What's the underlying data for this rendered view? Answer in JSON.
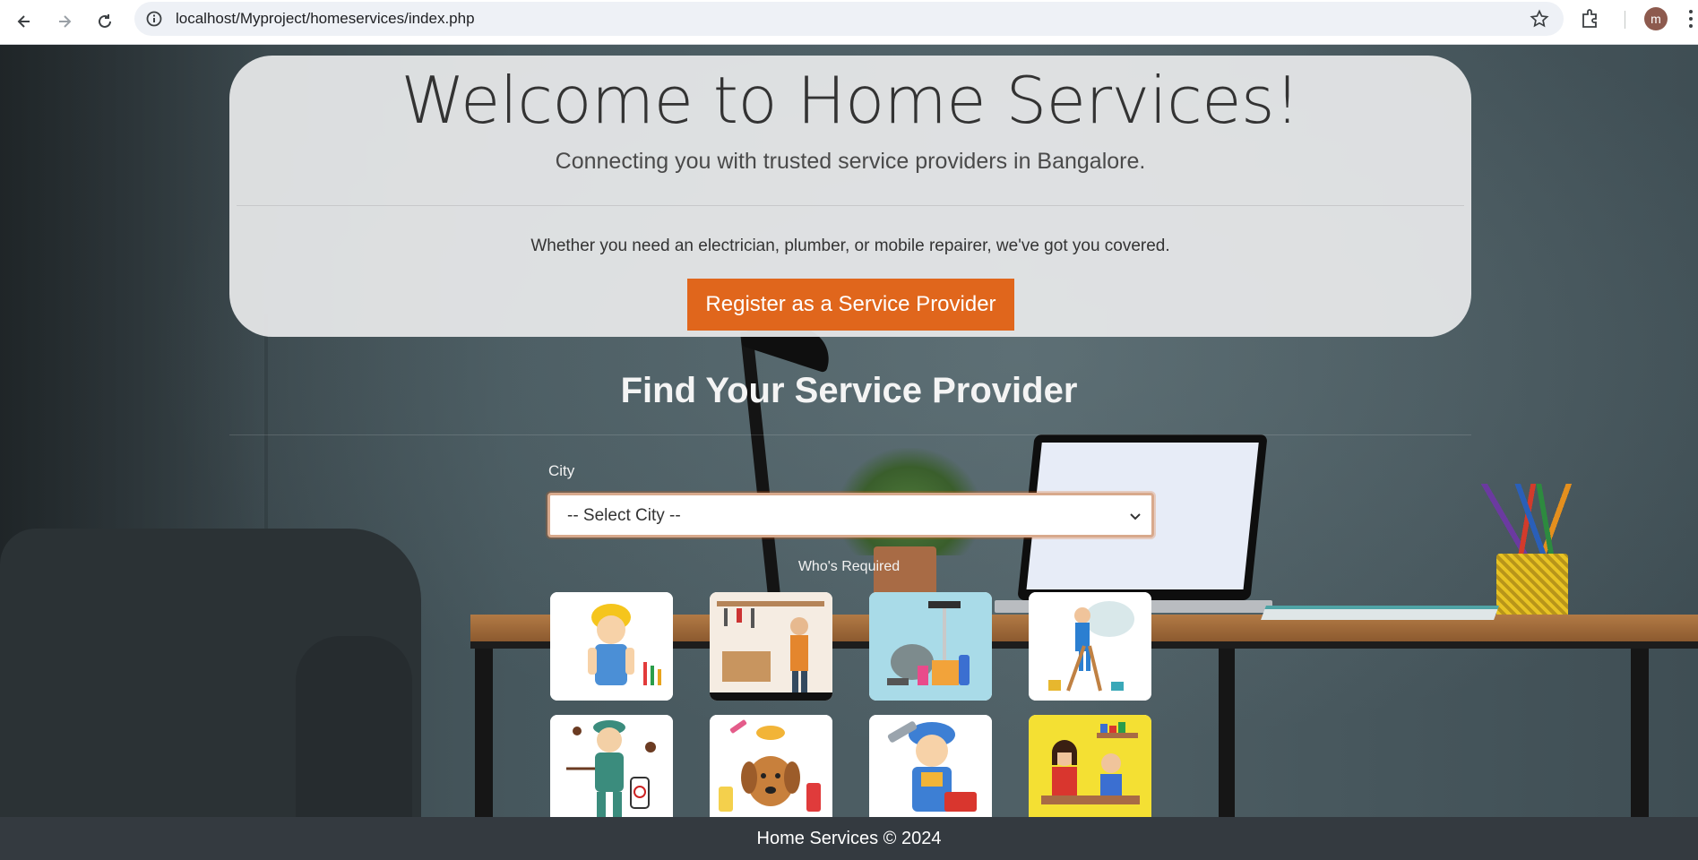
{
  "browser": {
    "url": "localhost/Myproject/homeservices/index.php",
    "profile_initial": "m"
  },
  "hero": {
    "title": "Welcome to Home Services!",
    "subtitle": "Connecting you with trusted service providers in Bangalore.",
    "description": "Whether you need an electrician, plumber, or mobile repairer, we've got you covered.",
    "register_label": "Register as a Service Provider"
  },
  "search": {
    "title": "Find Your Service Provider",
    "city_label": "City",
    "city_selected": "-- Select City --",
    "who_label": "Who's Required"
  },
  "services": [
    {
      "icon": "electrician-icon"
    },
    {
      "icon": "carpenter-icon"
    },
    {
      "icon": "cleaning-icon"
    },
    {
      "icon": "painter-icon"
    },
    {
      "icon": "pest-control-icon"
    },
    {
      "icon": "pet-grooming-icon"
    },
    {
      "icon": "plumber-icon"
    },
    {
      "icon": "tutor-icon"
    }
  ],
  "footer": {
    "text": "Home Services © 2024"
  },
  "colors": {
    "accent": "#e0661c",
    "footer_bg": "#343a40",
    "hero_bg": "#e8e9eb"
  }
}
